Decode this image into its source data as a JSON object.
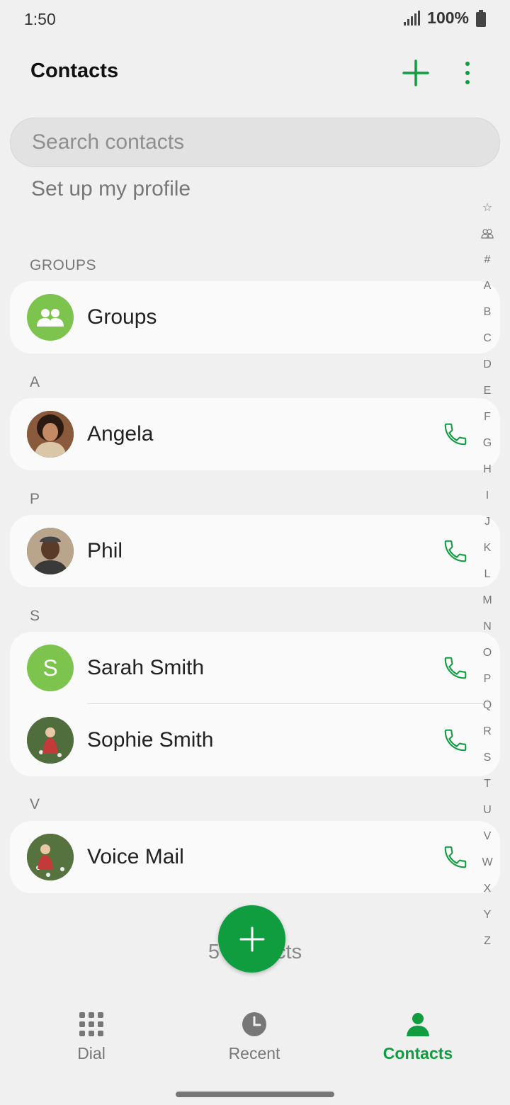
{
  "status": {
    "time": "1:50",
    "battery": "100%"
  },
  "header": {
    "title": "Contacts"
  },
  "search": {
    "placeholder": "Search contacts"
  },
  "profile_label": "Set up my profile",
  "groups_section": {
    "label": "GROUPS",
    "item": "Groups"
  },
  "sections": [
    {
      "letter": "A",
      "contacts": [
        "Angela"
      ]
    },
    {
      "letter": "P",
      "contacts": [
        "Phil"
      ]
    },
    {
      "letter": "S",
      "contacts": [
        "Sarah Smith",
        "Sophie Smith"
      ],
      "initial": "S"
    },
    {
      "letter": "V",
      "contacts": [
        "Voice Mail"
      ]
    }
  ],
  "index_letters": [
    "☆",
    "group",
    "#",
    "A",
    "B",
    "C",
    "D",
    "E",
    "F",
    "G",
    "H",
    "I",
    "J",
    "K",
    "L",
    "M",
    "N",
    "O",
    "P",
    "Q",
    "R",
    "S",
    "T",
    "U",
    "V",
    "W",
    "X",
    "Y",
    "Z"
  ],
  "count_label": "5 contacts",
  "nav": {
    "dial": "Dial",
    "recent": "Recent",
    "contacts": "Contacts"
  },
  "colors": {
    "accent": "#0f9d40",
    "avatar_green": "#7cc44e"
  }
}
